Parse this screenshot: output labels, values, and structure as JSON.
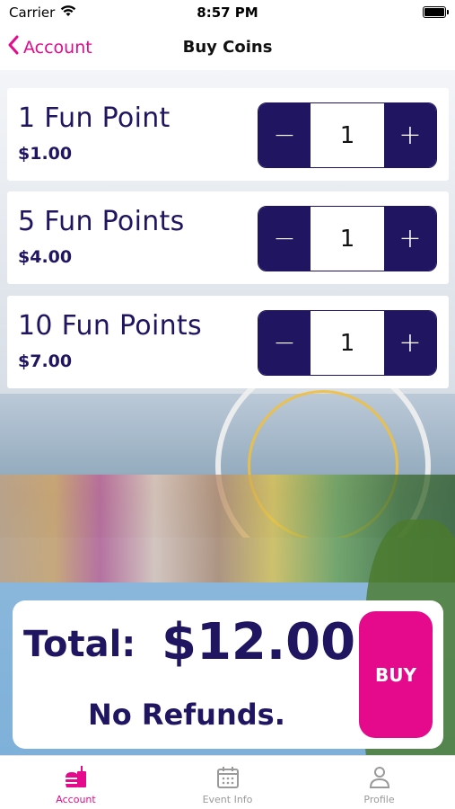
{
  "status_bar": {
    "carrier": "Carrier",
    "time": "8:57 PM"
  },
  "nav": {
    "back_label": "Account",
    "title": "Buy Coins"
  },
  "products": [
    {
      "name": "1 Fun Point",
      "price": "$1.00",
      "quantity": "1"
    },
    {
      "name": "5 Fun Points",
      "price": "$4.00",
      "quantity": "1"
    },
    {
      "name": "10 Fun Points",
      "price": "$7.00",
      "quantity": "1"
    }
  ],
  "stepper": {
    "minus": "−",
    "plus": "+"
  },
  "total": {
    "label": "Total:",
    "value": "$12.00",
    "note": "No Refunds.",
    "buy_label": "BUY"
  },
  "tabs": [
    {
      "label": "Account",
      "icon": "fast-food-icon",
      "active": true
    },
    {
      "label": "Event Info",
      "icon": "calendar-icon",
      "active": false
    },
    {
      "label": "Profile",
      "icon": "person-icon",
      "active": false
    }
  ],
  "colors": {
    "accent": "#e5098c",
    "primary": "#1f1561"
  }
}
